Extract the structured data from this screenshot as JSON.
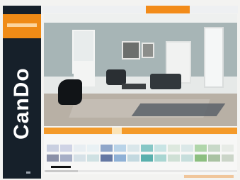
{
  "brand": {
    "logo_text": "CanDo",
    "accent": "#f08b16",
    "dark": "#16202a"
  },
  "nav": {
    "tabs": [
      {
        "label": "",
        "active": false
      },
      {
        "label": "",
        "active": false
      },
      {
        "label": "",
        "active": true
      },
      {
        "label": "",
        "active": false
      }
    ]
  },
  "scene": {
    "wall_color": "#a7b5b6",
    "floor_color": "#b8b0a5"
  },
  "toolbar": {
    "items": [
      {
        "label": "",
        "active": false
      },
      {
        "label": "",
        "active": false
      },
      {
        "label": "",
        "active": false
      },
      {
        "label": "",
        "active": true
      },
      {
        "label": "",
        "active": false
      },
      {
        "label": "",
        "active": false
      }
    ],
    "color": "#f49a2a"
  },
  "palette": {
    "left_label": "",
    "right_label": "",
    "colors_row1": [
      "#c9cfe0",
      "#cfd3e5",
      "#e8eef2",
      "#e9f1f4",
      "#8fa6c9",
      "#b9d3e8",
      "#d9e6ea",
      "#86c7c6",
      "#c8e4e4",
      "#dde8de",
      "#dbe8e8",
      "#b0d6aa",
      "#c8d9c8",
      "#e7ebe6"
    ],
    "colors_row2": [
      "#8a90a7",
      "#a6aec6",
      "#d6e1e7",
      "#cfe1e3",
      "#6478a3",
      "#8fb1d6",
      "#c3d9e0",
      "#59b0ad",
      "#a9d6d2",
      "#cfe0d5",
      "#c6dedc",
      "#8cbf80",
      "#a9c2a2",
      "#cbd5c8"
    ]
  }
}
